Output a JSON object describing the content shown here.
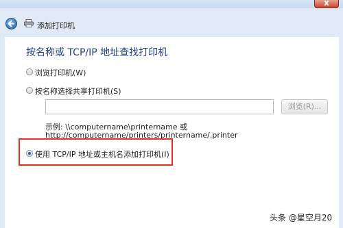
{
  "window": {
    "close_glyph": "x",
    "header_title": "添加打印机"
  },
  "page": {
    "heading": "按名称或 TCP/IP 地址查找打印机"
  },
  "options": {
    "browse_printers": "浏览打印机(W)",
    "select_shared": "按名称选择共享打印机(S)",
    "tcp_ip": "使用 TCP/IP 地址或主机名添加打印机(I)"
  },
  "shared": {
    "input_value": "",
    "browse_button": "浏览(R)...",
    "example_line1": "示例: \\\\computername\\printername 或",
    "example_line2": "http://computername/printers/printername/.printer"
  },
  "selected_option": "tcp_ip",
  "annotation": {
    "highlight_color": "#e5302c"
  },
  "watermark": "头条 @星空月20",
  "icons": {
    "back": "back-arrow-icon",
    "printer": "printer-icon"
  }
}
